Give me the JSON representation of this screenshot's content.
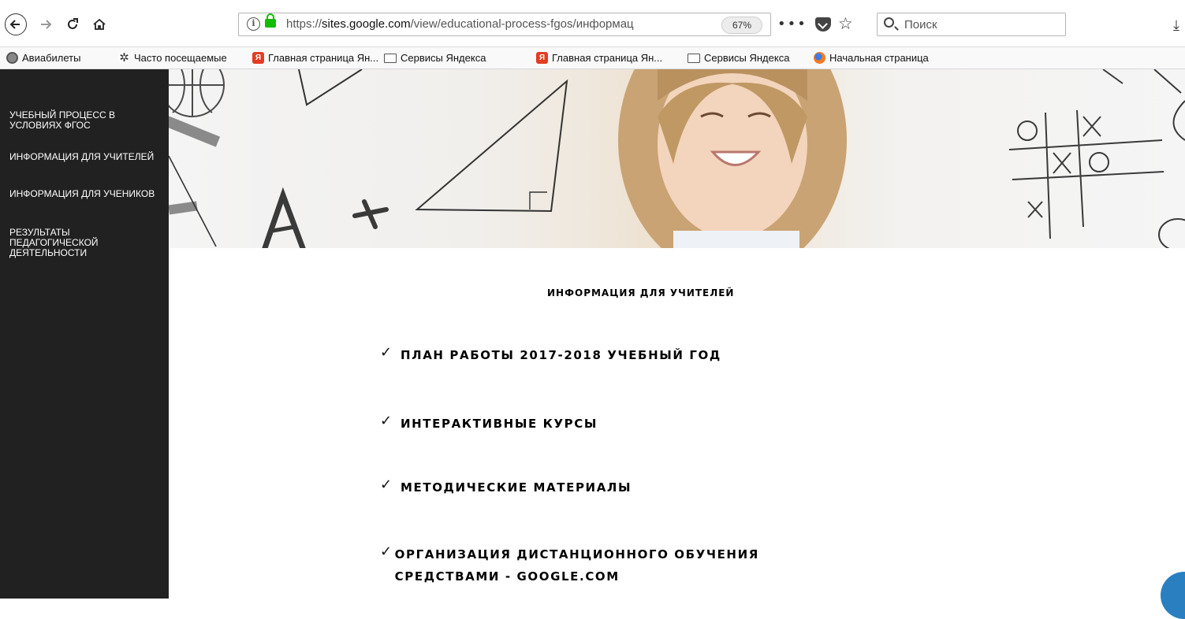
{
  "browser": {
    "url_prefix": "https://",
    "url_host": "sites.google.com",
    "url_path": "/view/educational-process-fgos/информац",
    "zoom_label": "67%",
    "page_actions": "•••",
    "search_placeholder": "Поиск"
  },
  "bookmarks": [
    {
      "label": "Авиабилеты",
      "icon": "plane-icon"
    },
    {
      "label": "Часто посещаемые",
      "icon": "gear-icon"
    },
    {
      "label": "Главная страница Ян...",
      "icon": "yandex-icon"
    },
    {
      "label": "Сервисы Яндекса",
      "icon": "folder-icon"
    },
    {
      "label": "Главная страница Ян...",
      "icon": "yandex-icon"
    },
    {
      "label": "Сервисы Яндекса",
      "icon": "folder-icon"
    },
    {
      "label": "Начальная страница",
      "icon": "firefox-icon"
    }
  ],
  "sidebar": {
    "items": [
      "УЧЕБНЫЙ ПРОЦЕСС В УСЛОВИЯХ ФГОС",
      "ИНФОРМАЦИЯ ДЛЯ УЧИТЕЛЕЙ",
      "ИНФОРМАЦИЯ ДЛЯ УЧЕНИКОВ",
      "РЕЗУЛЬТАТЫ ПЕДАГОГИЧЕСКОЙ ДЕЯТЕЛЬНОСТИ"
    ]
  },
  "main": {
    "heading": "ИНФОРМАЦИЯ ДЛЯ УЧИТЕЛЕЙ",
    "items": [
      "ПЛАН РАБОТЫ 2017-2018 УЧЕБНЫЙ ГОД",
      "ИНТЕРАКТИВНЫЕ КУРСЫ",
      "МЕТОДИЧЕСКИЕ МАТЕРИАЛЫ",
      "ОРГАНИЗАЦИЯ ДИСТАНЦИОННОГО ОБУЧЕНИЯ СРЕДСТВАМИ - GOOGLE.COM"
    ],
    "check_glyph": "✓"
  },
  "colors": {
    "sidebar_bg": "#212121",
    "lock_green": "#12bc00"
  }
}
